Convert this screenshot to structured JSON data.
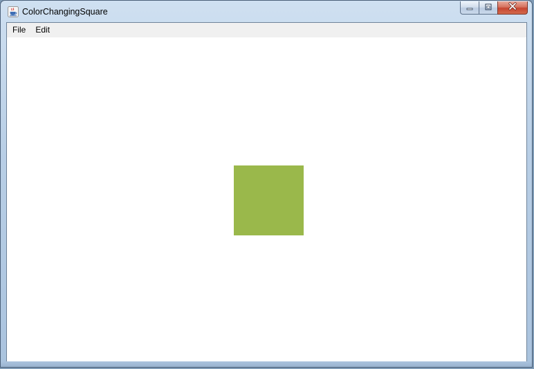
{
  "window": {
    "title": "ColorChangingSquare",
    "app_icon": "java-cup-icon"
  },
  "caption_buttons": {
    "minimize_icon": "minimize-icon",
    "maximize_icon": "maximize-icon",
    "close_icon": "close-icon"
  },
  "menubar": {
    "items": [
      "File",
      "Edit"
    ]
  },
  "square": {
    "color": "#9ab84b"
  }
}
